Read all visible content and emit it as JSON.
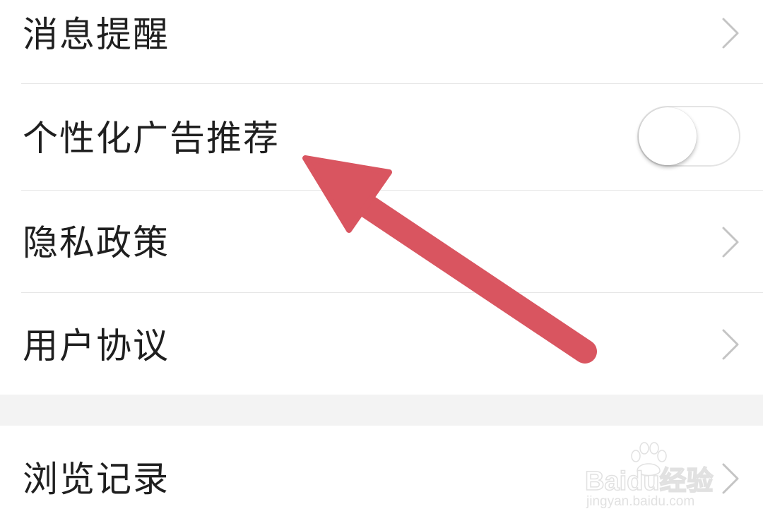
{
  "settings": {
    "items": [
      {
        "label": "消息提醒",
        "control": "chevron"
      },
      {
        "label": "个性化广告推荐",
        "control": "toggle",
        "toggle_on": false
      },
      {
        "label": "隐私政策",
        "control": "chevron"
      },
      {
        "label": "用户协议",
        "control": "chevron"
      },
      {
        "label": "浏览记录",
        "control": "chevron"
      }
    ]
  },
  "annotation": {
    "arrow_color": "#d95560"
  },
  "watermark": {
    "brand": "Baidu经验",
    "url": "jingyan.baidu.com"
  },
  "colors": {
    "text": "#1f1f1f",
    "divider": "#e6e6e6",
    "group_gap": "#f3f3f3",
    "chevron": "#c4c4c4"
  }
}
